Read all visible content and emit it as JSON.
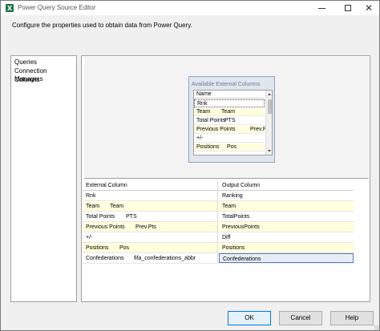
{
  "window": {
    "title": "Power Query Source Editor",
    "close_glyph": "✕"
  },
  "instruction": "Configure the properties used to obtain data from Power Query.",
  "nav": {
    "items": [
      "Queries",
      "Connection Managers",
      "Columns"
    ]
  },
  "available_columns": {
    "title": "Available External Columns",
    "header": "Name",
    "rows": [
      {
        "name": "Rnk",
        "alias": ""
      },
      {
        "name": "Team",
        "alias": "Team"
      },
      {
        "name": "Total Points",
        "alias": "PTS"
      },
      {
        "name": "Previous Points",
        "alias": "Prev.Pts"
      },
      {
        "name": "+/-",
        "alias": ""
      },
      {
        "name": "Positions",
        "alias": "Pos"
      }
    ]
  },
  "mapping": {
    "headers": {
      "external": "External Column",
      "output": "Output Column"
    },
    "rows": [
      {
        "external": "Rnk",
        "external_alias": "",
        "output": "Ranking"
      },
      {
        "external": "Team",
        "external_alias": "Team",
        "output": "Team"
      },
      {
        "external": "Total Points",
        "external_alias": "PTS",
        "output": "TotalPoints"
      },
      {
        "external": "Previous Points",
        "external_alias": "Prev.Pts",
        "output": "PreviousPoints"
      },
      {
        "external": "+/-",
        "external_alias": "",
        "output": "Diff"
      },
      {
        "external": "Positions",
        "external_alias": "Pos",
        "output": "Positions"
      },
      {
        "external": "Confederations",
        "external_alias": "fifa_confederations_abbr",
        "output": "Confederations"
      }
    ]
  },
  "buttons": {
    "ok": "OK",
    "cancel": "Cancel",
    "help": "Help"
  },
  "colors": {
    "row_highlight": "#ffffde",
    "selection_border": "#5a7cb3",
    "app_icon": "#1e7145"
  }
}
